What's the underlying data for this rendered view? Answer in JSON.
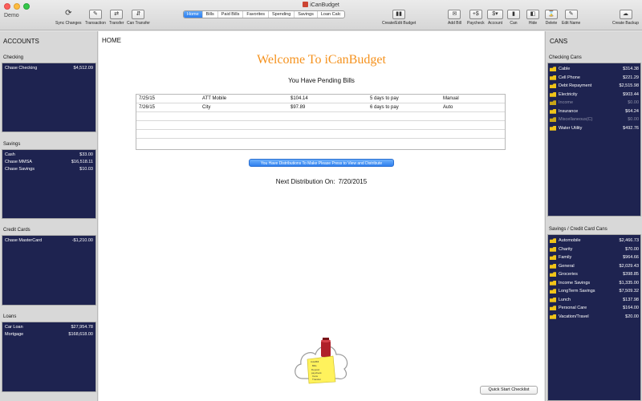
{
  "window": {
    "title": "iCanBudget",
    "document_name": "Demo"
  },
  "toolbar": {
    "left": [
      {
        "label": "Sync Changes",
        "icon": "sync-icon"
      },
      {
        "label": "Transaction",
        "icon": "transaction-icon"
      },
      {
        "label": "Transfer",
        "icon": "transfer-icon"
      },
      {
        "label": "Can Transfer",
        "icon": "can-transfer-icon"
      }
    ],
    "tabs": [
      "Home",
      "Bills",
      "Paid Bills",
      "Favorites",
      "Spending",
      "Savings",
      "Loan Calc"
    ],
    "active_tab": "Home",
    "middle": {
      "label": "Create/Edit Budget",
      "icon": "budget-icon"
    },
    "right": [
      {
        "label": "Add Bill",
        "icon": "add-bill-icon"
      },
      {
        "label": "Paycheck",
        "icon": "paycheck-icon"
      },
      {
        "label": "Account",
        "icon": "account-icon"
      },
      {
        "label": "Can",
        "icon": "can-icon"
      },
      {
        "label": "Hide",
        "icon": "hide-icon"
      },
      {
        "label": "Delete",
        "icon": "delete-icon"
      },
      {
        "label": "Edit Name",
        "icon": "edit-name-icon"
      }
    ],
    "backup": {
      "label": "Create Backup",
      "icon": "cloud-icon"
    }
  },
  "accounts": {
    "header": "ACCOUNTS",
    "groups": [
      {
        "title": "Checking",
        "rows": [
          {
            "name": "Chase Checking",
            "amount": "$4,512.09"
          }
        ]
      },
      {
        "title": "Savings",
        "rows": [
          {
            "name": "Cash",
            "amount": "$33.00"
          },
          {
            "name": "Chase MMSA",
            "amount": "$16,518.11"
          },
          {
            "name": "Chase Savings",
            "amount": "$10.03"
          }
        ]
      },
      {
        "title": "Credit Cards",
        "rows": [
          {
            "name": "Chase MasterCard",
            "amount": "-$1,210.00"
          }
        ]
      },
      {
        "title": "Loans",
        "rows": [
          {
            "name": "Car Loan",
            "amount": "$27,954.78"
          },
          {
            "name": "Mortgage",
            "amount": "$168,618.00"
          }
        ]
      }
    ]
  },
  "home": {
    "label": "HOME",
    "welcome": "Welcome To iCanBudget",
    "pending_title": "You Have Pending Bills",
    "bills": [
      {
        "date": "7/25/15",
        "payee": "ATT Mobile",
        "amount": "$104.14",
        "due": "5 days to pay",
        "method": "Manual"
      },
      {
        "date": "7/26/15",
        "payee": "City",
        "amount": "$97.89",
        "due": "6 days to pay",
        "method": "Auto"
      }
    ],
    "distribution_button": "You Have Distributions To Make Please Press to View and Distribute",
    "next_distribution_label": "Next Distribution On:",
    "next_distribution_date": "7/20/2015",
    "quick_start": "Quick Start Checklist",
    "logo_text": [
      "AutoBill",
      "Bills",
      "Deposit",
      "paycheck",
      "Cans",
      "Transfer"
    ]
  },
  "cans": {
    "header": "CANS",
    "groups": [
      {
        "title": "Checking Cans",
        "rows": [
          {
            "name": "Cable",
            "amount": "$314.38",
            "dim": false
          },
          {
            "name": "Cell Phone",
            "amount": "$221.29",
            "dim": false
          },
          {
            "name": "Debt Repayment",
            "amount": "$2,515.98",
            "dim": false
          },
          {
            "name": "Electricity",
            "amount": "$903.44",
            "dim": false
          },
          {
            "name": "Income",
            "amount": "$0.00",
            "dim": true
          },
          {
            "name": "Insurance",
            "amount": "$64.24",
            "dim": false
          },
          {
            "name": "Miscellaneous(C)",
            "amount": "$0.00",
            "dim": true
          },
          {
            "name": "Water Utility",
            "amount": "$492.76",
            "dim": false
          }
        ]
      },
      {
        "title": "Savings / Credit Card Cans",
        "rows": [
          {
            "name": "Automobile",
            "amount": "$2,466.73",
            "dim": false
          },
          {
            "name": "Charity",
            "amount": "$70.00",
            "dim": false
          },
          {
            "name": "Family",
            "amount": "$964.66",
            "dim": false
          },
          {
            "name": "General",
            "amount": "$2,029.43",
            "dim": false
          },
          {
            "name": "Groceries",
            "amount": "$398.85",
            "dim": false
          },
          {
            "name": "Income Savings",
            "amount": "$1,335.00",
            "dim": false
          },
          {
            "name": "LongTerm Savings",
            "amount": "$7,509.32",
            "dim": false
          },
          {
            "name": "Lunch",
            "amount": "$137.98",
            "dim": false
          },
          {
            "name": "Personal Care",
            "amount": "$164.00",
            "dim": false
          },
          {
            "name": "Vacation/Travel",
            "amount": "$20.00",
            "dim": false
          }
        ]
      }
    ]
  },
  "colors": {
    "panel": "#1e2350",
    "welcome": "#f5921e",
    "accent": "#2d7ff0",
    "can": "#f0c419"
  }
}
